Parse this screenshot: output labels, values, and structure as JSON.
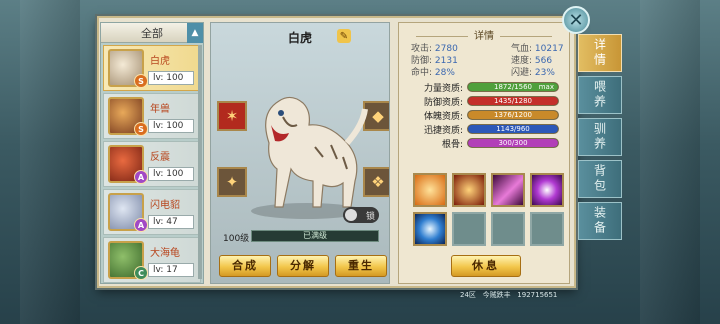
{
  "filter": {
    "label": "全部"
  },
  "pets": [
    {
      "name": "白虎",
      "level": "lv: 100",
      "grade": "S",
      "selected": true
    },
    {
      "name": "年兽",
      "level": "lv: 100",
      "grade": "S",
      "selected": false
    },
    {
      "name": "反震",
      "level": "lv: 100",
      "grade": "A",
      "selected": false
    },
    {
      "name": "闪电貂",
      "level": "lv: 47",
      "grade": "A",
      "selected": false
    },
    {
      "name": "大海龟",
      "level": "lv: 17",
      "grade": "C",
      "selected": false
    }
  ],
  "middle": {
    "title": "白虎",
    "lock_text": "锁",
    "level": "100级",
    "exp_text": "已满级",
    "buttons": {
      "merge": "合成",
      "decompose": "分解",
      "rebirth": "重生"
    }
  },
  "detail": {
    "header": "详情",
    "stats": {
      "attack_label": "攻击:",
      "attack": "2780",
      "hp_label": "气血:",
      "hp": "10217",
      "defense_label": "防御:",
      "defense": "2131",
      "speed_label": "速度:",
      "speed": "566",
      "hit_label": "命中:",
      "hit": "28%",
      "dodge_label": "闪避:",
      "dodge": "23%"
    },
    "aptitudes": [
      {
        "label": "力量资质:",
        "text": "1872/1560",
        "fill": 1.0,
        "color": "#4fa03c",
        "max": "max"
      },
      {
        "label": "防御资质:",
        "text": "1435/1280",
        "fill": 1.0,
        "color": "#c42f2a",
        "max": ""
      },
      {
        "label": "体魄资质:",
        "text": "1376/1200",
        "fill": 1.0,
        "color": "#c98a2a",
        "max": ""
      },
      {
        "label": "迅捷资质:",
        "text": "1143/960",
        "fill": 1.0,
        "color": "#2c58b8",
        "max": ""
      },
      {
        "label": "根骨:",
        "text": "300/300",
        "fill": 1.0,
        "color": "#b23fb8",
        "max": ""
      }
    ],
    "rest_button": "休息"
  },
  "tabs": [
    "详情",
    "喂养",
    "驯养",
    "背包",
    "装备"
  ],
  "footer": {
    "a": "24区",
    "b": "今贼跌丰",
    "c": "192715651"
  }
}
